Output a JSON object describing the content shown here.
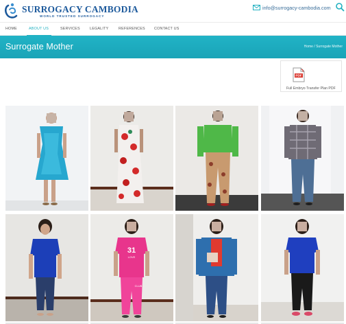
{
  "brand": {
    "name": "SURROGACY CAMBODIA",
    "tagline": "WORLD TRUSTED SURROGACY",
    "color": "#1d5a9c"
  },
  "header": {
    "email": "info@surrogacy-cambodia.com",
    "email_icon": "envelope-icon",
    "search_icon": "search-icon"
  },
  "nav": {
    "items": [
      {
        "label": "HOME"
      },
      {
        "label": "ABOUT US",
        "active": true
      },
      {
        "label": "SERVICES"
      },
      {
        "label": "LEGALITY"
      },
      {
        "label": "REFERENCES"
      },
      {
        "label": "CONTACT US"
      }
    ]
  },
  "banner": {
    "title": "Surrogate Mother",
    "breadcrumb": "Home / Surrogate Mother",
    "color": "#20b0c0"
  },
  "pdf_card": {
    "label": "Full Embryo Transfer Plan PDF",
    "icon": "pdf-file-icon",
    "icon_text": "PDF"
  },
  "gallery": {
    "photos": [
      {
        "name": "photo-1",
        "outfit": "blue floral dress"
      },
      {
        "name": "photo-2",
        "outfit": "red floral dress"
      },
      {
        "name": "photo-3",
        "outfit": "green top, patterned pants"
      },
      {
        "name": "photo-4",
        "outfit": "plaid shirt, jeans"
      },
      {
        "name": "photo-5",
        "outfit": "blue top, jeans"
      },
      {
        "name": "photo-6",
        "outfit": "pink outfit"
      },
      {
        "name": "photo-7",
        "outfit": "denim jacket, red top"
      },
      {
        "name": "photo-8",
        "outfit": "blue top, black pants"
      }
    ],
    "shirt_texts": [
      "31",
      "LOVE",
      "CLUB"
    ]
  }
}
